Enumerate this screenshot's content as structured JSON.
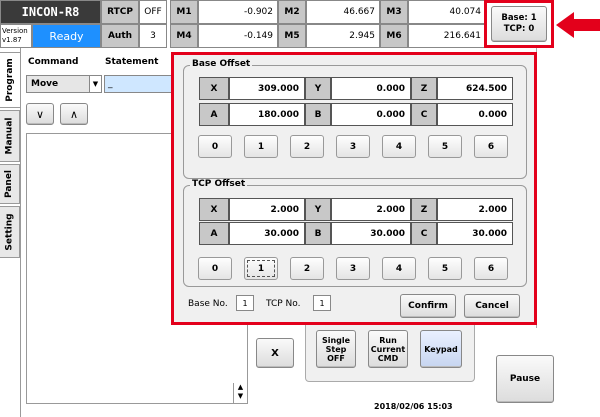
{
  "header": {
    "app_name": "INCON-R8",
    "version_label": "Version",
    "version": "v1.87",
    "status": "Ready",
    "rtcp_label": "RTCP",
    "rtcp_value": "OFF",
    "auth_label": "Auth",
    "auth_value": "3",
    "motors": [
      {
        "label": "M1",
        "value": "-0.902"
      },
      {
        "label": "M2",
        "value": "46.667"
      },
      {
        "label": "M3",
        "value": "40.074"
      },
      {
        "label": "M4",
        "value": "-0.149"
      },
      {
        "label": "M5",
        "value": "2.945"
      },
      {
        "label": "M6",
        "value": "216.641"
      }
    ],
    "base_tcp_line1": "Base: 1",
    "base_tcp_line2": "TCP: 0"
  },
  "tabs": [
    "Program",
    "Manual",
    "Panel",
    "Setting"
  ],
  "program": {
    "command_label": "Command",
    "statement_label": "Statement",
    "command_value": "Move",
    "statement_value": "_",
    "down_btn": "∨",
    "up_btn": "∧"
  },
  "background_buttons": {
    "x_btn": "X",
    "single_step": [
      "Single",
      "Step",
      "OFF"
    ],
    "run_current": [
      "Run",
      "Current",
      "CMD"
    ],
    "keypad": "Keypad",
    "pause": "Pause",
    "datetime": "2018/02/06 15:03"
  },
  "dialog": {
    "base_offset": {
      "title": "Base Offset",
      "fields": [
        {
          "label": "X",
          "value": "309.000"
        },
        {
          "label": "Y",
          "value": "0.000"
        },
        {
          "label": "Z",
          "value": "624.500"
        },
        {
          "label": "A",
          "value": "180.000"
        },
        {
          "label": "B",
          "value": "0.000"
        },
        {
          "label": "C",
          "value": "0.000"
        }
      ],
      "buttons": [
        "0",
        "1",
        "2",
        "3",
        "4",
        "5",
        "6"
      ]
    },
    "tcp_offset": {
      "title": "TCP Offset",
      "fields": [
        {
          "label": "X",
          "value": "2.000"
        },
        {
          "label": "Y",
          "value": "2.000"
        },
        {
          "label": "Z",
          "value": "2.000"
        },
        {
          "label": "A",
          "value": "30.000"
        },
        {
          "label": "B",
          "value": "30.000"
        },
        {
          "label": "C",
          "value": "30.000"
        }
      ],
      "buttons": [
        "0",
        "1",
        "2",
        "3",
        "4",
        "5",
        "6"
      ],
      "selected": "1"
    },
    "base_no_label": "Base No.",
    "base_no_value": "1",
    "tcp_no_label": "TCP No.",
    "tcp_no_value": "1",
    "confirm": "Confirm",
    "cancel": "Cancel"
  },
  "colors": {
    "highlight_red": "#e3001b",
    "ready_blue": "#1e90ff"
  }
}
